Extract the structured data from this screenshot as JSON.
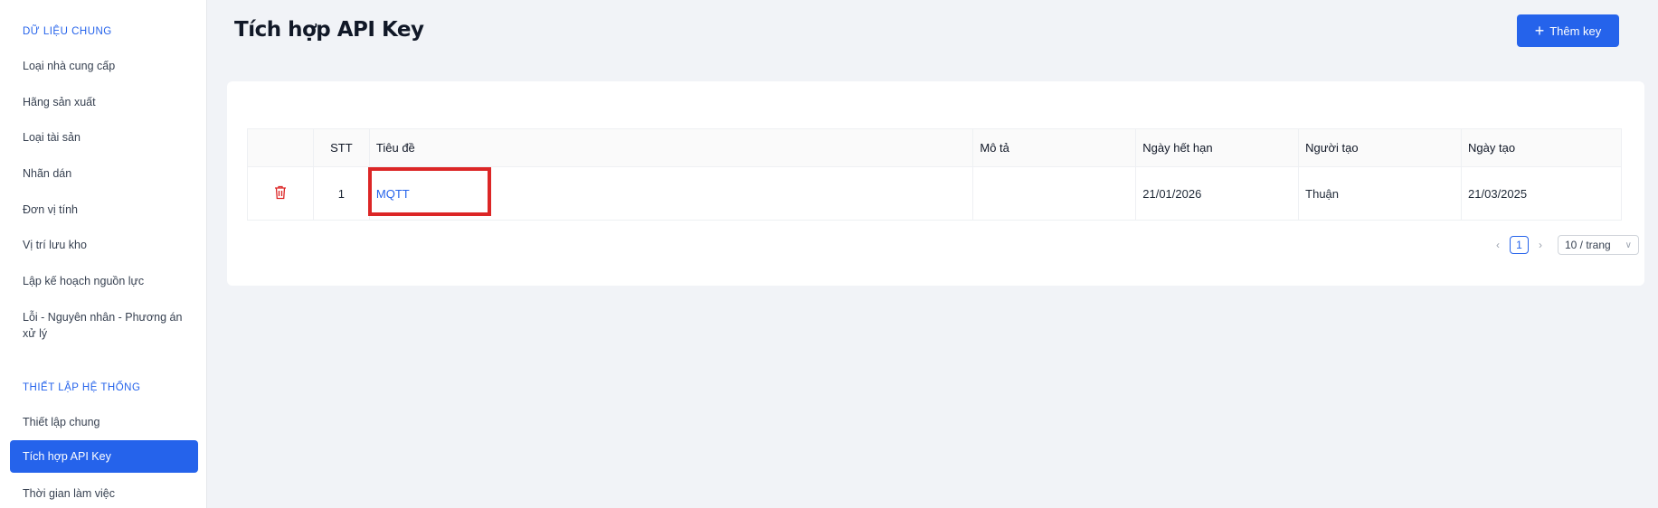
{
  "sidebar": {
    "section1": "DỮ LIỆU CHUNG",
    "items1": [
      {
        "label": "Loại nhà cung cấp"
      },
      {
        "label": "Hãng sản xuất"
      },
      {
        "label": "Loại tài sản"
      },
      {
        "label": "Nhãn dán"
      },
      {
        "label": "Đơn vị tính"
      },
      {
        "label": "Vị trí lưu kho"
      },
      {
        "label": "Lập kế hoạch nguồn lực"
      },
      {
        "label": "Lỗi - Nguyên nhân - Phương án xử lý"
      }
    ],
    "section2": "THIẾT LẬP HỆ THỐNG",
    "items2": [
      {
        "label": "Thiết lập chung"
      },
      {
        "label": "Tích hợp API Key",
        "active": true
      },
      {
        "label": "Thời gian làm việc"
      }
    ]
  },
  "header": {
    "title": "Tích hợp API Key",
    "add_button": "Thêm key"
  },
  "table": {
    "columns": [
      "STT",
      "Tiêu đề",
      "Mô tả",
      "Ngày hết hạn",
      "Người tạo",
      "Ngày tạo"
    ],
    "rows": [
      {
        "stt": "1",
        "title": "MQTT",
        "desc": "",
        "expiry": "21/01/2026",
        "creator": "Thuận",
        "created": "21/03/2025"
      }
    ]
  },
  "pagination": {
    "current_page": "1",
    "page_size": "10 / trang"
  },
  "colors": {
    "accent": "#2563eb",
    "danger": "#dc2626"
  }
}
